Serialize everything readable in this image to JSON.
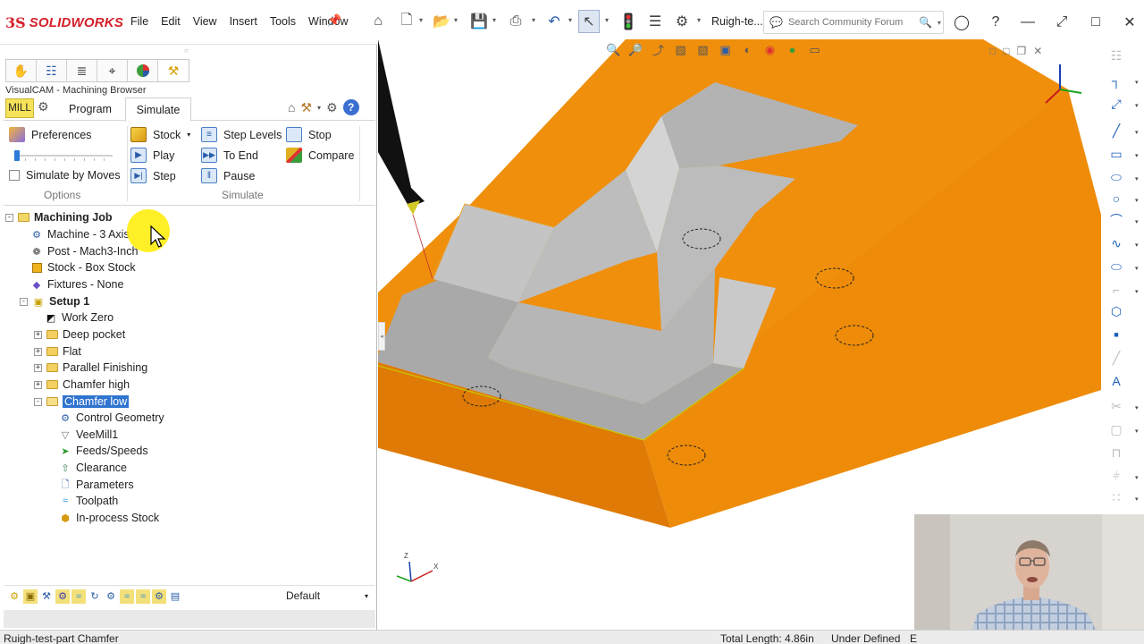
{
  "app": {
    "logo_prefix": "3S",
    "logo_name": "SOLIDWORKS",
    "menus": [
      "File",
      "Edit",
      "View",
      "Insert",
      "Tools",
      "Window"
    ],
    "document_title": "Ruigh-te...",
    "search_placeholder": "Search Community Forum"
  },
  "left_panel": {
    "browser_title": "VisualCAM - Machining Browser",
    "mill_tab": "MILL",
    "tabs": [
      "Program",
      "Simulate"
    ],
    "active_tab": "Simulate",
    "ribbon": {
      "preferences": "Preferences",
      "simulate_by_moves": "Simulate by Moves",
      "options_group": "Options",
      "stock": "Stock",
      "play": "Play",
      "step": "Step",
      "step_levels": "Step Levels",
      "to_end": "To End",
      "pause": "Pause",
      "stop": "Stop",
      "compare": "Compare",
      "simulate_group": "Simulate"
    },
    "tree": {
      "root": "Machining Job",
      "machine": "Machine - 3 Axis",
      "post": "Post - Mach3-Inch",
      "stock": "Stock - Box Stock",
      "fixtures": "Fixtures - None",
      "setup": "Setup 1",
      "work_zero": "Work Zero",
      "operations": [
        "Deep pocket",
        "Flat",
        "Parallel Finishing",
        "Chamfer high",
        "Chamfer low"
      ],
      "selected_operation": "Chamfer low",
      "op_children": [
        "Control Geometry",
        "VeeMill1",
        "Feeds/Speeds",
        "Clearance",
        "Parameters",
        "Toolpath",
        "In-process Stock"
      ]
    },
    "configuration": "Default"
  },
  "status_bar": {
    "document": "Ruigh-test-part Chamfer",
    "total_length": "Total Length: 4.86in",
    "definition": "Under Defined",
    "extra": "E"
  },
  "viewport": {
    "triad_labels": [
      "Z",
      "X"
    ]
  },
  "colors": {
    "part_orange": "#ef8f0c",
    "floor_grey": "#a8a8a8",
    "selection_blue": "#2f74d0",
    "mill_tab_yellow": "#f6e35a",
    "brand_red": "#d5202a"
  }
}
